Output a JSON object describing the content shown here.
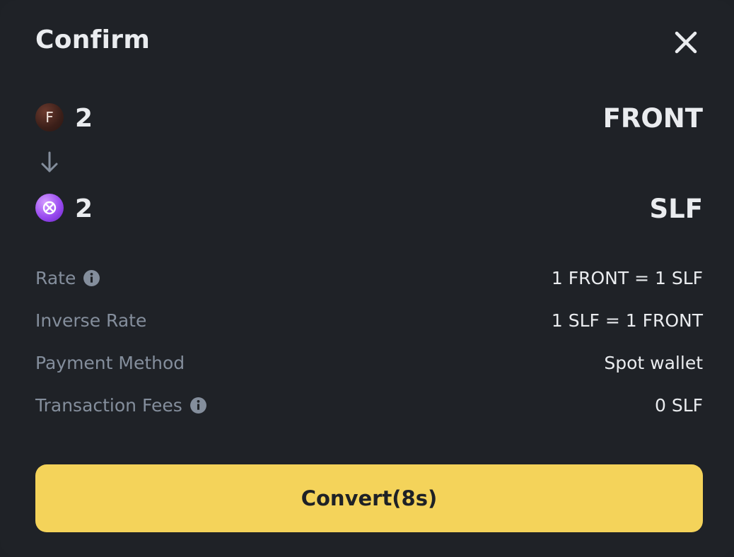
{
  "dialog": {
    "title": "Confirm"
  },
  "from": {
    "amount": "2",
    "symbol": "FRONT",
    "icon_glyph": "F",
    "icon": "front-coin-icon"
  },
  "to": {
    "amount": "2",
    "symbol": "SLF",
    "icon": "slf-coin-icon"
  },
  "details": {
    "rate_label": "Rate",
    "rate_value": "1 FRONT = 1 SLF",
    "inverse_rate_label": "Inverse Rate",
    "inverse_rate_value": "1 SLF = 1 FRONT",
    "payment_method_label": "Payment Method",
    "payment_method_value": "Spot wallet",
    "fees_label": "Transaction Fees",
    "fees_value": "0 SLF"
  },
  "actions": {
    "convert_label": "Convert(8s)"
  },
  "colors": {
    "background": "#1f2227",
    "primary_text": "#eaecef",
    "secondary_text": "#848e9c",
    "accent": "#f4d35a"
  }
}
